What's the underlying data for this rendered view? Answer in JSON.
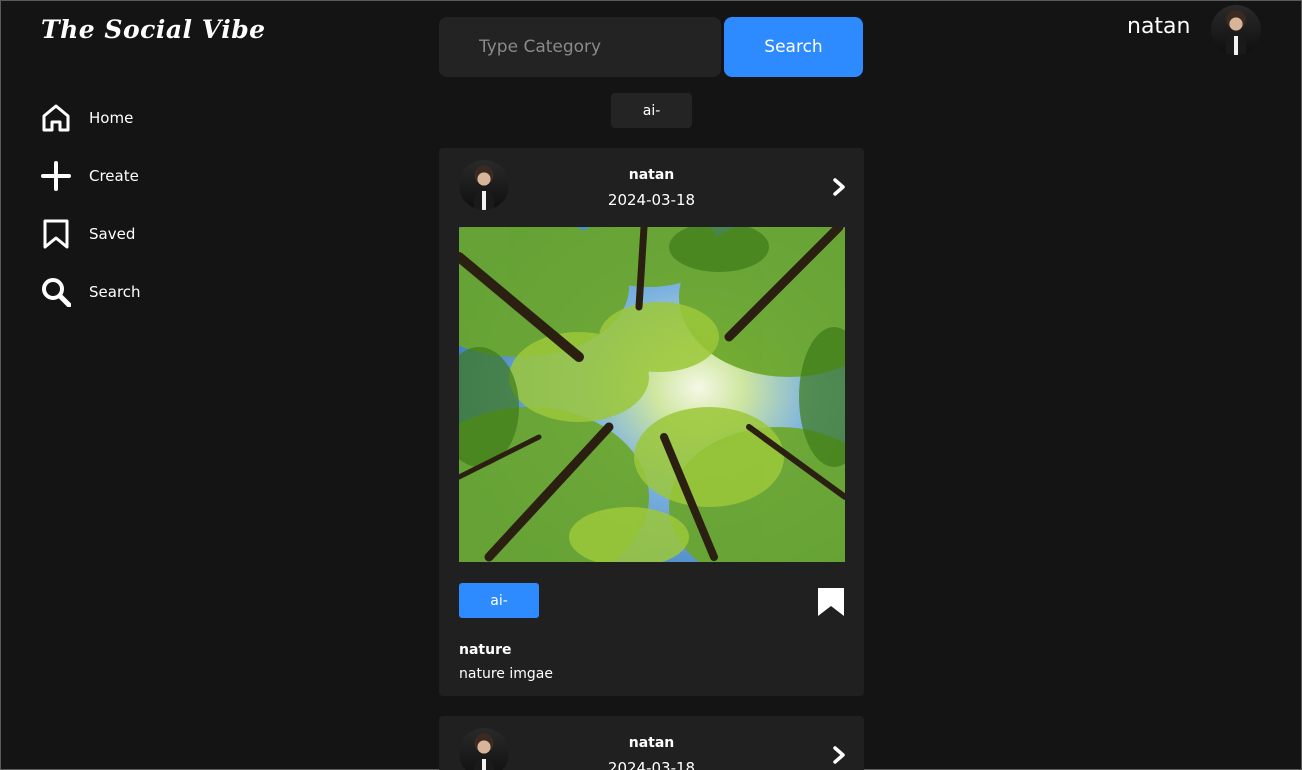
{
  "app": {
    "title": "The Social Vibe"
  },
  "nav": {
    "items": [
      {
        "label": "Home",
        "icon": "home-icon"
      },
      {
        "label": "Create",
        "icon": "plus-icon"
      },
      {
        "label": "Saved",
        "icon": "bookmark-icon"
      },
      {
        "label": "Search",
        "icon": "search-icon"
      }
    ]
  },
  "search": {
    "placeholder": "Type Category",
    "button_label": "Search"
  },
  "filter": {
    "active_chip": "ai-"
  },
  "user": {
    "name": "natan"
  },
  "posts": [
    {
      "author": "natan",
      "date": "2024-03-18",
      "tag": "ai-",
      "title": "nature",
      "description": "nature imgae"
    },
    {
      "author": "natan",
      "date": "2024-03-18"
    }
  ],
  "colors": {
    "accent": "#2e8bff",
    "background": "#141414",
    "card": "#202020"
  }
}
